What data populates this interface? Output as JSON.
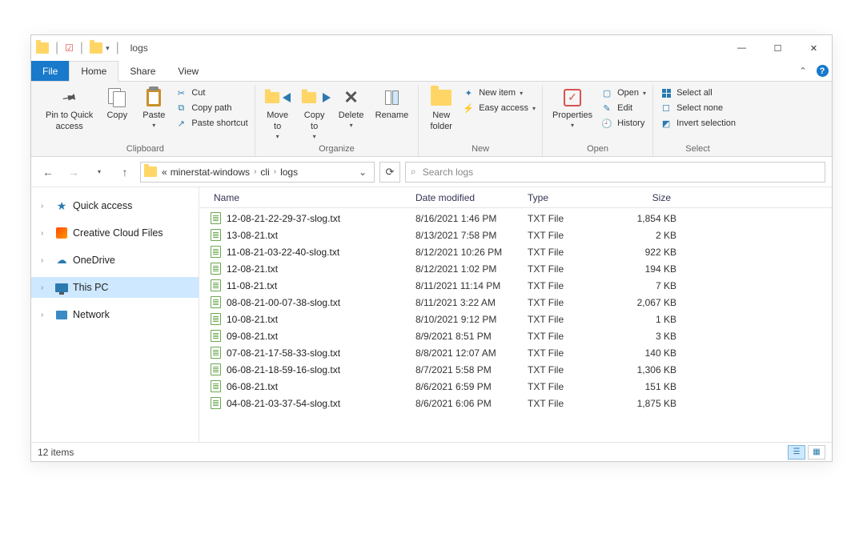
{
  "title": "logs",
  "tabs": {
    "file": "File",
    "home": "Home",
    "share": "Share",
    "view": "View"
  },
  "ribbon": {
    "clipboard": {
      "label": "Clipboard",
      "pin": "Pin to Quick\naccess",
      "copy": "Copy",
      "paste": "Paste",
      "cut": "Cut",
      "copy_path": "Copy path",
      "paste_shortcut": "Paste shortcut"
    },
    "organize": {
      "label": "Organize",
      "move_to": "Move\nto",
      "copy_to": "Copy\nto",
      "delete": "Delete",
      "rename": "Rename"
    },
    "new": {
      "label": "New",
      "new_folder": "New\nfolder",
      "new_item": "New item",
      "easy_access": "Easy access"
    },
    "open": {
      "label": "Open",
      "properties": "Properties",
      "open": "Open",
      "edit": "Edit",
      "history": "History"
    },
    "select": {
      "label": "Select",
      "select_all": "Select all",
      "select_none": "Select none",
      "invert": "Invert selection"
    }
  },
  "address": {
    "crumbs": [
      "minerstat-windows",
      "cli",
      "logs"
    ],
    "prefix": "«"
  },
  "search": {
    "placeholder": "Search logs"
  },
  "columns": {
    "name": "Name",
    "date": "Date modified",
    "type": "Type",
    "size": "Size"
  },
  "nav": {
    "quick_access": "Quick access",
    "creative_cloud": "Creative Cloud Files",
    "onedrive": "OneDrive",
    "this_pc": "This PC",
    "network": "Network"
  },
  "files": [
    {
      "name": "12-08-21-22-29-37-slog.txt",
      "date": "8/16/2021 1:46 PM",
      "type": "TXT File",
      "size": "1,854 KB"
    },
    {
      "name": "13-08-21.txt",
      "date": "8/13/2021 7:58 PM",
      "type": "TXT File",
      "size": "2 KB"
    },
    {
      "name": "11-08-21-03-22-40-slog.txt",
      "date": "8/12/2021 10:26 PM",
      "type": "TXT File",
      "size": "922 KB"
    },
    {
      "name": "12-08-21.txt",
      "date": "8/12/2021 1:02 PM",
      "type": "TXT File",
      "size": "194 KB"
    },
    {
      "name": "11-08-21.txt",
      "date": "8/11/2021 11:14 PM",
      "type": "TXT File",
      "size": "7 KB"
    },
    {
      "name": "08-08-21-00-07-38-slog.txt",
      "date": "8/11/2021 3:22 AM",
      "type": "TXT File",
      "size": "2,067 KB"
    },
    {
      "name": "10-08-21.txt",
      "date": "8/10/2021 9:12 PM",
      "type": "TXT File",
      "size": "1 KB"
    },
    {
      "name": "09-08-21.txt",
      "date": "8/9/2021 8:51 PM",
      "type": "TXT File",
      "size": "3 KB"
    },
    {
      "name": "07-08-21-17-58-33-slog.txt",
      "date": "8/8/2021 12:07 AM",
      "type": "TXT File",
      "size": "140 KB"
    },
    {
      "name": "06-08-21-18-59-16-slog.txt",
      "date": "8/7/2021 5:58 PM",
      "type": "TXT File",
      "size": "1,306 KB"
    },
    {
      "name": "06-08-21.txt",
      "date": "8/6/2021 6:59 PM",
      "type": "TXT File",
      "size": "151 KB"
    },
    {
      "name": "04-08-21-03-37-54-slog.txt",
      "date": "8/6/2021 6:06 PM",
      "type": "TXT File",
      "size": "1,875 KB"
    }
  ],
  "status": {
    "count": "12 items"
  }
}
